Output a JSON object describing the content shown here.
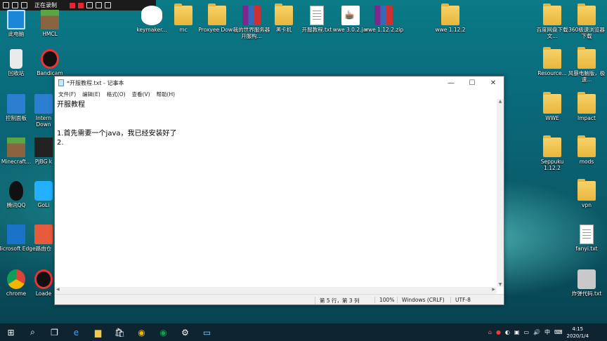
{
  "recorder": {
    "label": "正在录制"
  },
  "desktop_left": [
    {
      "label": "此电脑",
      "icon": "computer-icon"
    },
    {
      "label": "回收站",
      "icon": "recycle-bin-icon"
    },
    {
      "label": "控制面板",
      "icon": "control-panel-icon"
    },
    {
      "label": "Minecraft...",
      "icon": "minecraft-icon"
    },
    {
      "label": "腾讯QQ",
      "icon": "qq-icon"
    },
    {
      "label": "Microsoft Edge",
      "icon": "edge-icon"
    },
    {
      "label": "chrome",
      "icon": "chrome-icon"
    }
  ],
  "desktop_col2": [
    {
      "label": "HMCL",
      "icon": "minecraft-block-icon"
    },
    {
      "label": "Bandicam",
      "icon": "bandicam-icon"
    },
    {
      "label": "Intern Down",
      "icon": "download-icon"
    },
    {
      "label": "PJBG k",
      "icon": "pubg-icon"
    },
    {
      "label": "GoLi",
      "icon": "app-icon"
    },
    {
      "label": "路由仓",
      "icon": "router-icon"
    },
    {
      "label": "Loade",
      "icon": "loader-icon"
    }
  ],
  "desktop_top": [
    {
      "label": "keymaker...",
      "icon": "hat-icon"
    },
    {
      "label": "mc",
      "icon": "folder-icon"
    },
    {
      "label": "Proxyee Down",
      "icon": "folder-icon"
    },
    {
      "label": "我的世界服务器开服构...",
      "icon": "rar-icon"
    },
    {
      "label": "黑卡机",
      "icon": "folder-icon"
    },
    {
      "label": "开服教程.txt",
      "icon": "text-file-icon"
    },
    {
      "label": "wwe 3.0.2.jar",
      "icon": "java-icon"
    },
    {
      "label": "wwe 1.12.2.zip",
      "icon": "rar-icon"
    },
    {
      "label": "wwe 1.12.2",
      "icon": "folder-icon"
    }
  ],
  "desktop_right": [
    {
      "label": "百度网盘下载文...",
      "icon": "folder-icon"
    },
    {
      "label": "360极速浏览器下载",
      "icon": "folder-icon"
    },
    {
      "label": "Resource...",
      "icon": "folder-icon"
    },
    {
      "label": "风暴电脑版，极速...",
      "icon": "folder-icon"
    },
    {
      "label": "WWE",
      "icon": "folder-icon"
    },
    {
      "label": "Impact",
      "icon": "folder-icon"
    },
    {
      "label": "Seppuku 1.12.2",
      "icon": "folder-icon"
    },
    {
      "label": "mods",
      "icon": "folder-icon"
    },
    {
      "label": "vpn",
      "icon": "folder-icon"
    },
    {
      "label": "fanyi.txt",
      "icon": "text-file-icon"
    },
    {
      "label": "炸弹代码.txt",
      "icon": "settings-file-icon"
    }
  ],
  "notepad": {
    "title": "*开服教程.txt - 记事本",
    "menu": [
      "文件(F)",
      "编辑(E)",
      "格式(O)",
      "查看(V)",
      "帮助(H)"
    ],
    "content": "开服教程\n\n\n1.首先需要一个java，我已经安装好了\n2.",
    "status": {
      "position": "第 5 行，第 3 列",
      "zoom": "100%",
      "line_ending": "Windows (CRLF)",
      "encoding": "UTF-8"
    }
  },
  "taskbar": {
    "time": "4:15",
    "date": "2020/1/4",
    "ime": "中"
  }
}
